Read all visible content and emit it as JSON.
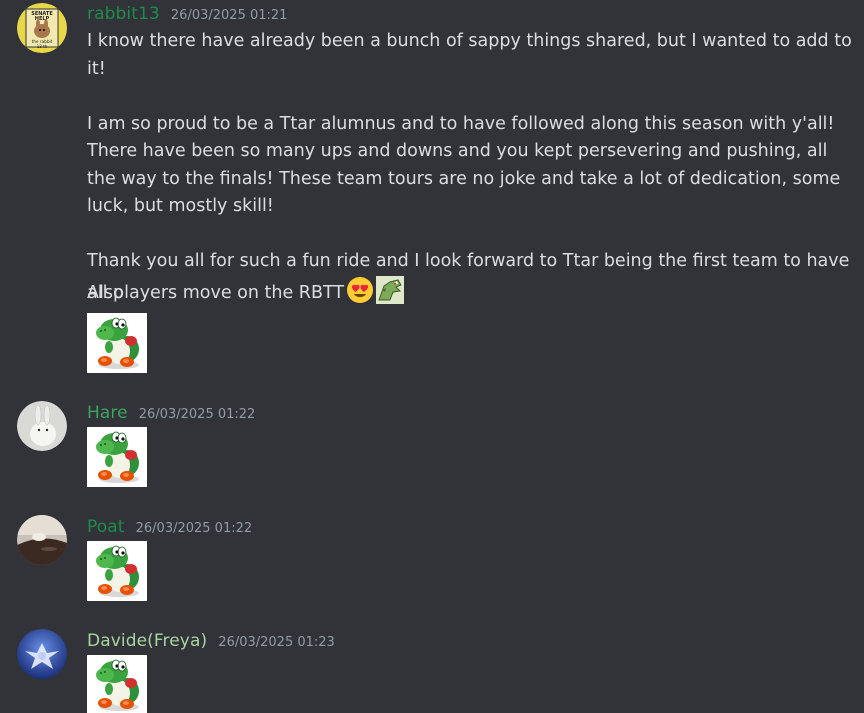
{
  "messages": [
    {
      "username": "rabbit13",
      "timestamp": "26/03/2025 01:21",
      "username_color": "#1f8b4c",
      "avatar": "rabbit-logo-avatar",
      "avatar_text": [
        "SENATE",
        "HELP",
        "the rabbit",
        "13 th"
      ],
      "paragraphs": [
        "I know there have already been a bunch of sappy things shared, but I wanted to add to it!",
        "I am so proud to be a Ttar alumnus and to have followed along this season with y'all! There have been so many ups and downs and you kept persevering and pushing, all the way to the finals! These team tours are no joke and take a lot of dedication, some luck, but mostly skill!",
        "Thank you all for such a fun ride and I look forward to Ttar being the first team to have all players move on the RBTT"
      ],
      "emojis": [
        "heart-eyes-emoji",
        "tyranitar-emoji"
      ],
      "extra_line": "Also",
      "sticker": "yoshi-sticker"
    },
    {
      "username": "Hare",
      "timestamp": "26/03/2025 01:22",
      "username_color": "#3ba55d",
      "avatar": "white-hare-avatar",
      "sticker": "yoshi-sticker"
    },
    {
      "username": "Poat",
      "timestamp": "26/03/2025 01:22",
      "username_color": "#1f8b4c",
      "avatar": "poat-avatar",
      "sticker": "yoshi-sticker"
    },
    {
      "username": "Davide(Freya)",
      "timestamp": "26/03/2025 01:23",
      "username_color": "#a8d5a2",
      "avatar": "freya-avatar",
      "sticker": "yoshi-sticker"
    }
  ]
}
